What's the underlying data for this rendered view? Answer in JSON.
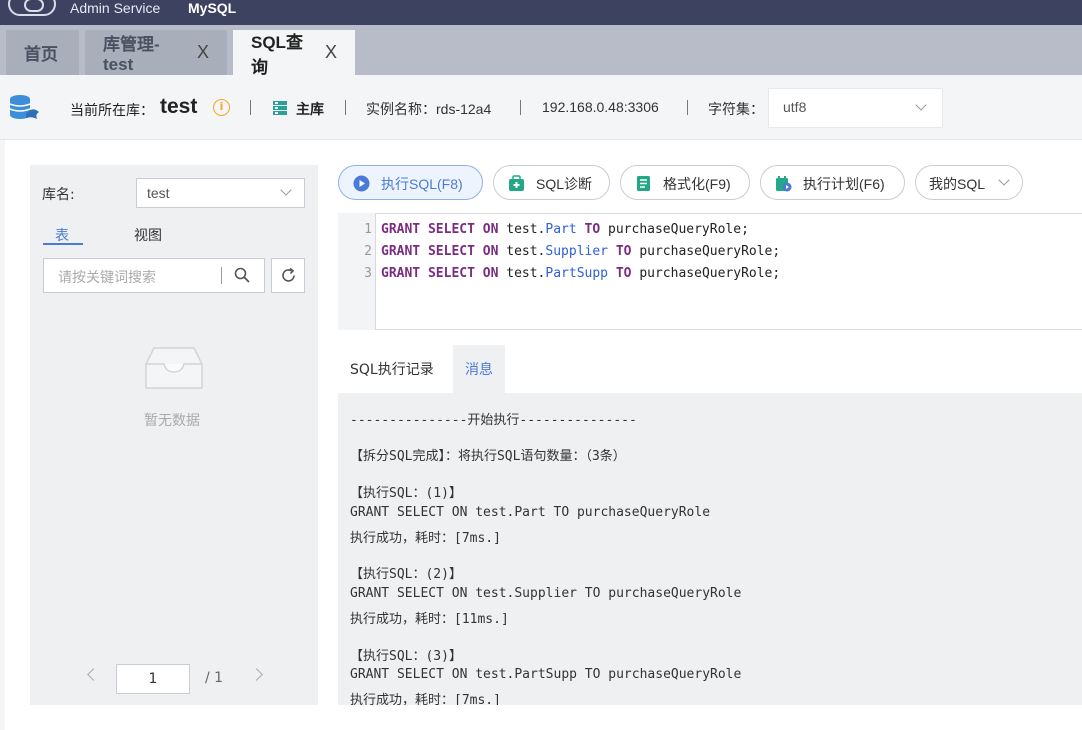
{
  "topbar": {
    "brand": "Admin Service",
    "db_type": "MySQL"
  },
  "tabs": [
    {
      "label": "首页",
      "closable": false
    },
    {
      "label": "库管理-test",
      "closable": true
    },
    {
      "label": "SQL查询",
      "closable": true,
      "active": true
    }
  ],
  "close_glyph": "X",
  "dbbar": {
    "current_db_label": "当前所在库：",
    "current_db": "test",
    "role": "主库",
    "instance": "实例名称：rds-12a4",
    "address": "192.168.0.48:3306",
    "charset_label": "字符集：",
    "charset_value": "utf8"
  },
  "leftpane": {
    "lib_label": "库名:",
    "lib_value": "test",
    "tab_tables": "表",
    "tab_views": "视图",
    "search_placeholder": "请按关键词搜索",
    "empty_text": "暂无数据",
    "page_current": "1",
    "page_total": "/ 1"
  },
  "toolbar": {
    "execute": "执行SQL(F8)",
    "diagnose": "SQL诊断",
    "format": "格式化(F9)",
    "plan": "执行计划(F6)",
    "my_sql": "我的SQL"
  },
  "editor": {
    "lines": [
      {
        "n": "1",
        "grant": "GRANT",
        "select": "SELECT",
        "on": "ON",
        "schema": " test.",
        "table": "Part",
        "to": "TO",
        "role": " purchaseQueryRole;"
      },
      {
        "n": "2",
        "grant": "GRANT",
        "select": "SELECT",
        "on": "ON",
        "schema": " test.",
        "table": "Supplier",
        "to": "TO",
        "role": " purchaseQueryRole;"
      },
      {
        "n": "3",
        "grant": "GRANT",
        "select": "SELECT",
        "on": "ON",
        "schema": " test.",
        "table": "PartSupp",
        "to": "TO",
        "role": " purchaseQueryRole;"
      }
    ]
  },
  "result_tabs": {
    "history": "SQL执行记录",
    "messages": "消息"
  },
  "messages": [
    "---------------开始执行---------------",
    "【拆分SQL完成】：将执行SQL语句数量：（3条）",
    "【执行SQL：(1)】",
    "GRANT SELECT ON test.Part TO purchaseQueryRole",
    "执行成功，耗时：[7ms.]",
    "【执行SQL：(2)】",
    "GRANT SELECT ON test.Supplier TO purchaseQueryRole",
    "执行成功，耗时：[11ms.]",
    "【执行SQL：(3)】",
    "GRANT SELECT ON test.PartSupp TO purchaseQueryRole",
    "执行成功，耗时：[7ms.]"
  ],
  "colors": {
    "accent": "#4b7bd6",
    "topbar": "#3c4260",
    "keyword": "#7b2c82",
    "warning": "#f5a623"
  }
}
